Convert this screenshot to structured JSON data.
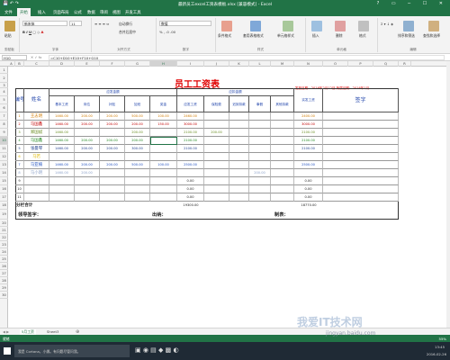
{
  "window": {
    "title": "最新员工excel工资表模板.xlsx [兼容模式] - Excel",
    "controls": "? ▭ ─ ☐ ✕"
  },
  "ribbon": {
    "tabs": [
      "文件",
      "开始",
      "插入",
      "页面布局",
      "公式",
      "数据",
      "审阅",
      "视图",
      "开发工具"
    ],
    "active_tab": "开始",
    "font_name": "新宋体",
    "font_size": "11",
    "number_format": "数值",
    "clipboard": {
      "paste": "粘贴",
      "group": "剪贴板"
    },
    "font_group": "字体",
    "align_group": "对齐方式",
    "number_group": "数字",
    "styles": {
      "cond": "条件格式",
      "table": "套用表格格式",
      "cell": "单元格样式",
      "group": "样式"
    },
    "cells": {
      "insert": "插入",
      "delete": "删除",
      "format": "格式",
      "group": "单元格"
    },
    "edit": {
      "sort": "排序和筛选",
      "find": "查找和选择",
      "group": "编辑"
    },
    "align_items": {
      "wrap": "自动换行",
      "merge": "合并后居中"
    }
  },
  "formula_bar": {
    "name_box": "H10",
    "formula": "=C10+D10+E10+F10+G10"
  },
  "columns": [
    "A",
    "B",
    "C",
    "D",
    "E",
    "F",
    "G",
    "H",
    "I",
    "J",
    "K",
    "L",
    "M",
    "N",
    "O",
    "P",
    "Q",
    "R"
  ],
  "rows": [
    "1",
    "2",
    "3",
    "4",
    "5",
    "6",
    "7",
    "8",
    "9",
    "10",
    "11",
    "12",
    "13",
    "14",
    "15",
    "16",
    "17",
    "18",
    "19",
    "20",
    "21",
    "22",
    "23",
    "24",
    "25",
    "26",
    "27",
    "28",
    "29",
    "30"
  ],
  "sheet": {
    "title": "员工工资表",
    "date_line": "发放日期：2016年2月12日   所属日期：2016年1月",
    "h_no": "编号",
    "h_name": "姓名",
    "h_payable": "应发金额",
    "h_deduct": "应扣金额",
    "h_base": "基本工资",
    "h_post": "岗位",
    "h_perf": "补贴",
    "h_overtime": "加班",
    "h_bonus": "奖金",
    "h_total": "应发工资",
    "h_d1": "保险费",
    "h_d2": "迟到扣款",
    "h_d3": "事假",
    "h_d4": "其他扣款",
    "h_actual": "实发工资",
    "h_sign": "签字",
    "total_label": "分栏合计",
    "leader": "领导签字：",
    "cashier": "出纳：",
    "maker": "制表：",
    "data_rows": [
      {
        "no": "1",
        "name": "王志明",
        "vals": [
          "1460.00",
          "200.00",
          "200.00",
          "500.00",
          "100.00"
        ],
        "total": "2460.00",
        "d": [
          "",
          "",
          "",
          ""
        ],
        "actual": "2400.00",
        "color": "#d07a00"
      },
      {
        "no": "2",
        "name": "马国鑫",
        "vals": [
          "1460.00",
          "200.00",
          "200.00",
          "200.00",
          "150.00"
        ],
        "total": "3000.00",
        "d": [
          "",
          "",
          "",
          ""
        ],
        "actual": "3000.00",
        "color": "#c00000"
      },
      {
        "no": "3",
        "name": "郑国斌",
        "vals": [
          "1460.00",
          "",
          "",
          "200.00",
          ""
        ],
        "total": "2100.00",
        "d": [
          "200.00",
          "",
          "",
          ""
        ],
        "actual": "2100.00",
        "color": "#6b8e23"
      },
      {
        "no": "4",
        "name": "马国鑫",
        "vals": [
          "1460.00",
          "200.00",
          "200.00",
          "200.00",
          ""
        ],
        "total": "2100.00",
        "d": [
          "",
          "",
          "",
          ""
        ],
        "actual": "2100.00",
        "color": "#228b22"
      },
      {
        "no": "5",
        "name": "张曼琴",
        "vals": [
          "1460.00",
          "200.00",
          "200.00",
          "300.00",
          ""
        ],
        "total": "2100.00",
        "d": [
          "",
          "",
          "",
          ""
        ],
        "actual": "2100.00",
        "color": "#1f3f8f"
      },
      {
        "no": "6",
        "name": "马若",
        "vals": [
          "",
          "",
          "",
          "",
          ""
        ],
        "total": "",
        "d": [
          "",
          "",
          "",
          ""
        ],
        "actual": "",
        "color": "#e0b800"
      },
      {
        "no": "7",
        "name": "马亚楠",
        "vals": [
          "1460.00",
          "200.00",
          "200.00",
          "500.00",
          "100.00"
        ],
        "total": "2500.00",
        "d": [
          "",
          "",
          "",
          ""
        ],
        "actual": "2500.00",
        "color": "#1f4fbf"
      },
      {
        "no": "8",
        "name": "马小明",
        "vals": [
          "1460.00",
          "200.00",
          "",
          "",
          ""
        ],
        "total": "",
        "d": [
          "",
          "",
          "200.00",
          ""
        ],
        "actual": "",
        "color": "#8aa0c8"
      },
      {
        "no": "9",
        "name": "",
        "vals": [
          "",
          "",
          "",
          "",
          ""
        ],
        "total": "0.00",
        "d": [
          "",
          "",
          "",
          ""
        ],
        "actual": "0.00",
        "color": "#222"
      },
      {
        "no": "10",
        "name": "",
        "vals": [
          "",
          "",
          "",
          "",
          ""
        ],
        "total": "0.00",
        "d": [
          "",
          "",
          "",
          ""
        ],
        "actual": "0.00",
        "color": "#222"
      },
      {
        "no": "11",
        "name": "",
        "vals": [
          "",
          "",
          "",
          "",
          ""
        ],
        "total": "0.00",
        "d": [
          "",
          "",
          "",
          ""
        ],
        "actual": "0.00",
        "color": "#222"
      }
    ],
    "grand_total": "19300.00",
    "grand_actual": "18770.00"
  },
  "sheet_tabs": [
    "5月工资",
    "Sheet3"
  ],
  "status": {
    "left": "就绪",
    "zoom": "55%"
  },
  "taskbar": {
    "search": "我是 Cortana，小娜。有问题尽管问我。",
    "time": "13:45",
    "date": "2016-02-26",
    "watermark": "我爱IT技术网",
    "watermark_url": "jingyan.baidu.com"
  },
  "colors": {
    "excel_green": "#217346",
    "title_red": "#e00000"
  }
}
